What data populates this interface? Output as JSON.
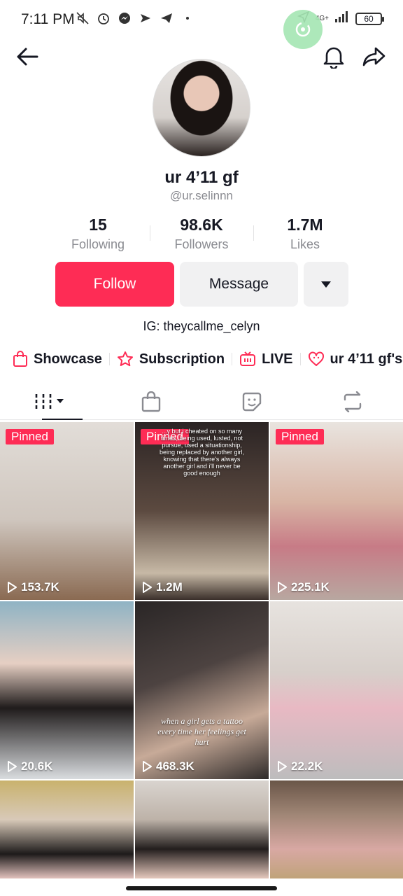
{
  "status_bar": {
    "time": "7:11 PM",
    "network": "4G+",
    "battery": "60"
  },
  "profile": {
    "display_name": "ur 4’11 gf",
    "username": "@ur.selinnn",
    "stats": [
      {
        "value": "15",
        "label": "Following"
      },
      {
        "value": "98.6K",
        "label": "Followers"
      },
      {
        "value": "1.7M",
        "label": "Likes"
      }
    ],
    "follow_label": "Follow",
    "message_label": "Message",
    "bio": "IG: theycallme_celyn"
  },
  "links": [
    {
      "label": "Showcase",
      "icon": "shopping-bag-icon"
    },
    {
      "label": "Subscription",
      "icon": "star-badge-icon"
    },
    {
      "label": "LIVE",
      "icon": "live-tv-icon"
    },
    {
      "label": "ur 4’11 gf's",
      "icon": "sticker-heart-icon"
    }
  ],
  "tabs": [
    {
      "name": "videos",
      "icon": "videos-grid-icon"
    },
    {
      "name": "shop",
      "icon": "shopping-bag-icon"
    },
    {
      "name": "favorites",
      "icon": "sticker-icon"
    },
    {
      "name": "reposts",
      "icon": "repost-icon"
    }
  ],
  "videos": [
    {
      "pinned_label": "Pinned",
      "views": "153.7K",
      "bg": "#d9d4cf"
    },
    {
      "pinned_label": "Pinned",
      "views": "1.2M",
      "bg": "#4a3a32",
      "caption": "...y but i cheated on so many times, being used, lusted, not pursue, used a situationship, being replaced by another girl, knowing that there's always another girl and i'll never be good enough"
    },
    {
      "pinned_label": "Pinned",
      "views": "225.1K",
      "bg": "#c9b8ae"
    },
    {
      "pinned_label": "",
      "views": "20.6K",
      "bg": "#a9b6bd"
    },
    {
      "pinned_label": "",
      "views": "468.3K",
      "bg": "#3b3533",
      "caption": "when a girl gets a tattoo every time her feelings get hurt"
    },
    {
      "pinned_label": "",
      "views": "22.2K",
      "bg": "#d6cfc9"
    },
    {
      "pinned_label": "",
      "views": "",
      "bg": "#b9a36b"
    },
    {
      "pinned_label": "",
      "views": "",
      "bg": "#cfc7bf"
    },
    {
      "pinned_label": "",
      "views": "",
      "bg": "#6a5a50"
    }
  ],
  "colors": {
    "accent": "#fe2c55",
    "secondary_button": "#f1f1f2",
    "muted_text": "#8a8b91"
  }
}
